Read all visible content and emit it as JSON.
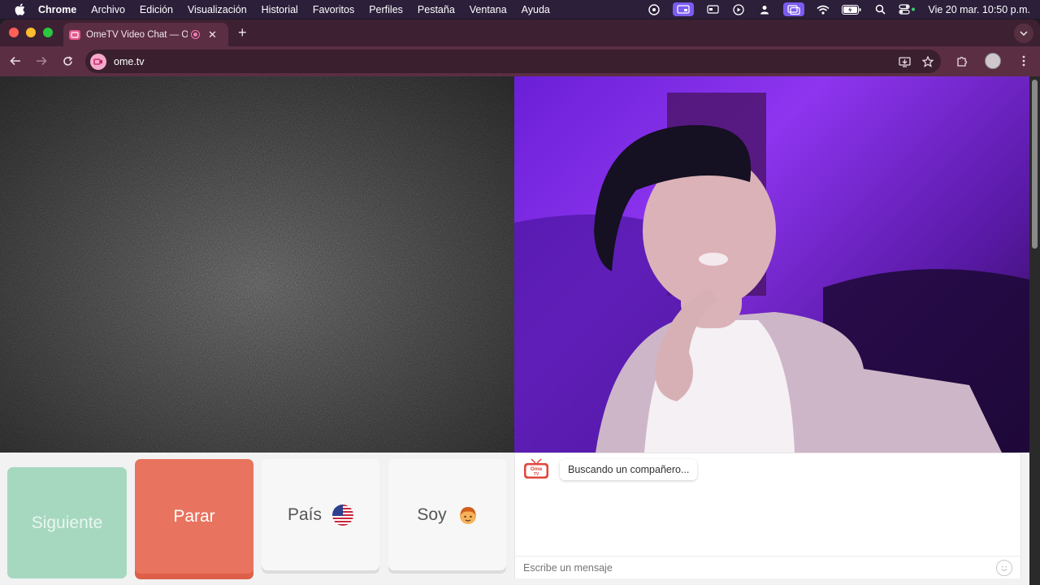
{
  "menubar": {
    "app_name": "Chrome",
    "items": [
      "Archivo",
      "Edición",
      "Visualización",
      "Historial",
      "Favoritos",
      "Perfiles",
      "Pestaña",
      "Ventana",
      "Ayuda"
    ],
    "clock": "Vie 20 mar.  10:50 p.m."
  },
  "browser": {
    "tab_title": "OmeTV Video Chat — Omegle",
    "url": "ome.tv"
  },
  "controls": {
    "next_label": "Siguiente",
    "stop_label": "Parar",
    "country_label": "País",
    "gender_label": "Soy"
  },
  "chat": {
    "logo_text": "Ome TV",
    "status_message": "Buscando un compañero...",
    "input_placeholder": "Escribe un mensaje"
  },
  "colors": {
    "next_button": "#a6d8c0",
    "stop_button": "#e8735f",
    "tab_active": "#5b2e44",
    "accent": "#7b5cf0"
  }
}
